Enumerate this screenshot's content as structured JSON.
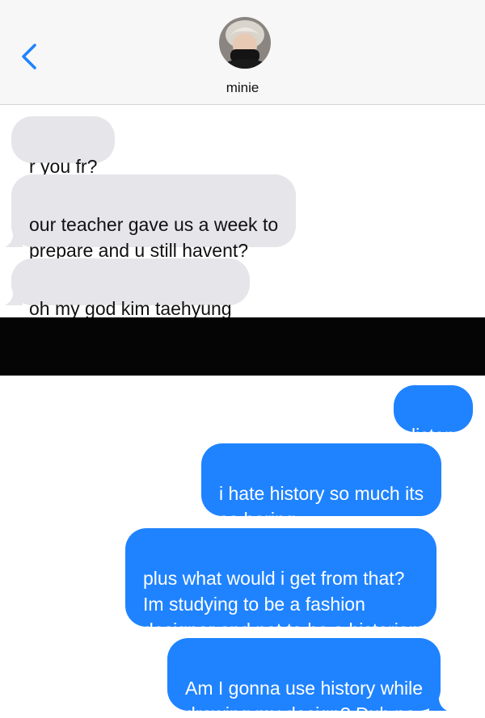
{
  "header": {
    "contact_name": "minie",
    "back_icon": "chevron-left-icon",
    "accent_color": "#1f83ff"
  },
  "incoming_messages": [
    {
      "text": "r you fr?"
    },
    {
      "text": "our teacher gave us a week to\nprepare and u still havent?"
    },
    {
      "text": "oh my god kim taehyung"
    }
  ],
  "outgoing_messages": [
    {
      "text": "listen"
    },
    {
      "text": "i hate history so much its\nso boring"
    },
    {
      "text": "plus what would i get from that?\nIm studying to be a fashion\ndesigner and not to be a historian"
    },
    {
      "text": "Am I gonna use history while\ndrawing my design? Duh no"
    }
  ],
  "colors": {
    "incoming_bubble": "#e5e5ea",
    "outgoing_bubble": "#1f83ff",
    "header_background": "#f7f7f7",
    "divider_band": "#050505"
  }
}
